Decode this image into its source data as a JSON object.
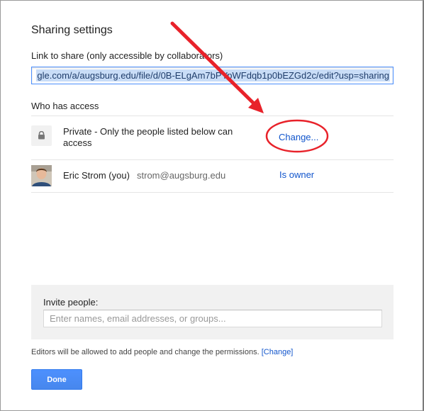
{
  "dialog": {
    "title": "Sharing settings",
    "link_label": "Link to share (only accessible by collaborators)",
    "link_value": "gle.com/a/augsburg.edu/file/d/0B-ELgAm7bPYpWFdqb1p0bEZGd2c/edit?usp=sharing",
    "access_label": "Who has access",
    "private_text": "Private - Only the people listed below can access",
    "change_label": "Change...",
    "person_name": "Eric Strom (you)",
    "person_email": "strom@augsburg.edu",
    "owner_label": "Is owner",
    "invite_label": "Invite people:",
    "invite_placeholder": "Enter names, email addresses, or groups...",
    "note_text": "Editors will be allowed to add people and change the permissions.",
    "note_link_label": "[Change]",
    "done_label": "Done"
  },
  "colors": {
    "link_blue": "#1155cc",
    "button_blue": "#4d90fe",
    "annotation_red": "#e8222a"
  },
  "icons": {
    "lock": "lock-icon",
    "avatar": "avatar"
  }
}
